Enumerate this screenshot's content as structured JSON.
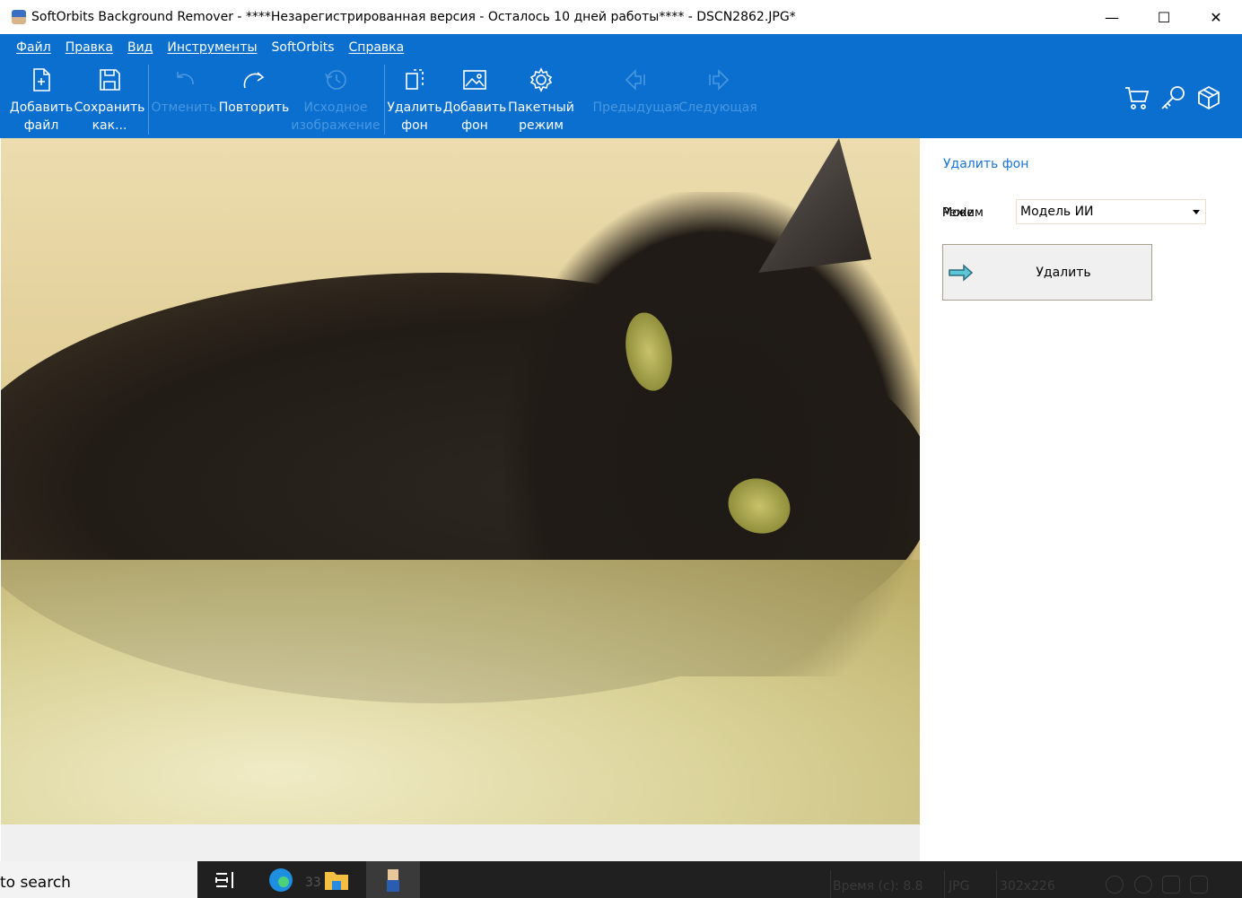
{
  "window": {
    "title": "SoftOrbits Background Remover - ****Незарегистрированная версия - Осталось 10 дней работы**** - DSCN2862.JPG*",
    "minimize": "—",
    "maximize": "☐",
    "close": "✕"
  },
  "menu": [
    "Файл",
    "Правка",
    "Вид",
    "Инструменты",
    "SoftOrbits",
    "Справка"
  ],
  "toolbar": {
    "add_file": [
      "Добавить",
      "файл"
    ],
    "save_as": [
      "Сохранить",
      "как..."
    ],
    "undo": [
      "Отменить"
    ],
    "redo": [
      "Повторить"
    ],
    "original": [
      "Исходное",
      "изображение"
    ],
    "remove_bg": [
      "Удалить",
      "фон"
    ],
    "add_bg": [
      "Добавить",
      "фон"
    ],
    "batch": [
      "Пакетный",
      "режим"
    ],
    "prev": [
      "Предыдущая"
    ],
    "next": [
      "Следующая"
    ]
  },
  "panel": {
    "title": "Удалить фон",
    "mode_label_a": "Mode",
    "mode_label_b": "Режим",
    "mode_value": "Модель ИИ",
    "remove_button": "Удалить"
  },
  "taskbar": {
    "search": "to search",
    "badge": "33"
  },
  "status": {
    "time": "Время (с): 8.8",
    "format": "JPG",
    "size": "302x226"
  }
}
